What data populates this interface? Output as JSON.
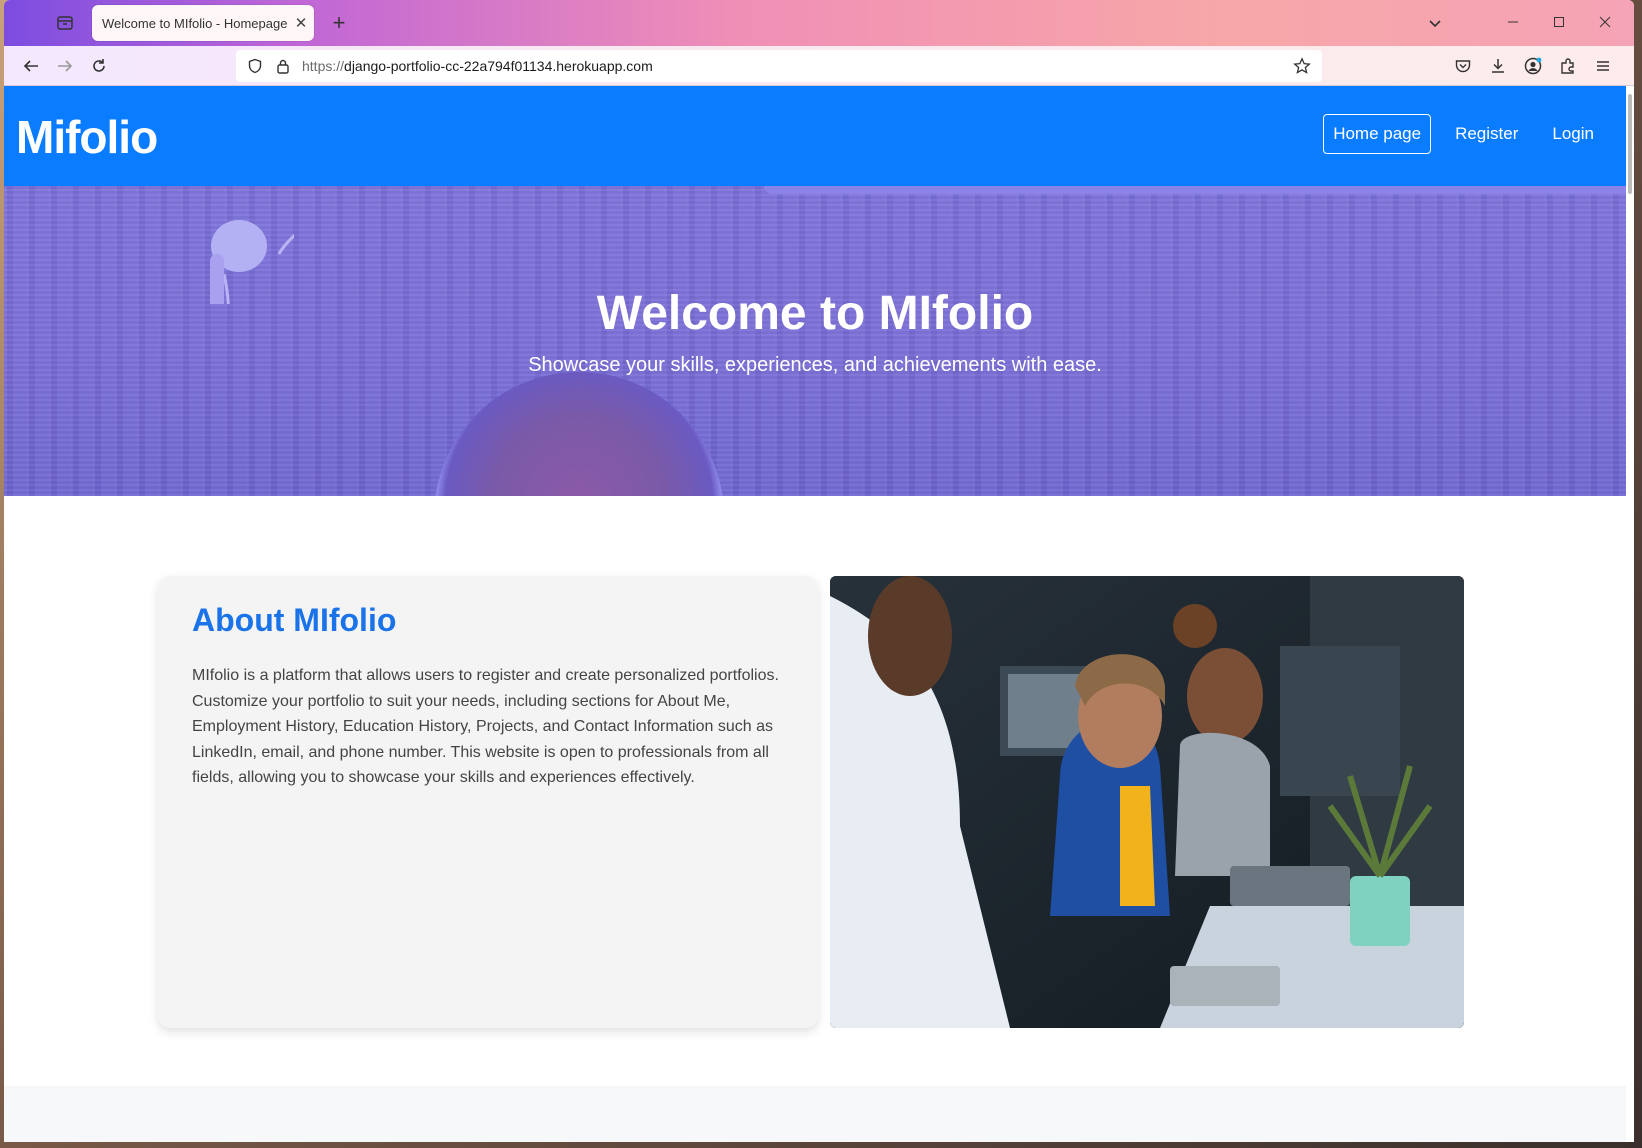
{
  "browser": {
    "tab": {
      "title": "Welcome to MIfolio - Homepage"
    },
    "url": {
      "protocol": "https://",
      "host": "django-portfolio-cc-22a794f01134.herokuapp.com"
    }
  },
  "site": {
    "brand": "Mifolio",
    "nav": [
      {
        "label": "Home page",
        "active": true
      },
      {
        "label": "Register",
        "active": false
      },
      {
        "label": "Login",
        "active": false
      }
    ],
    "hero": {
      "title": "Welcome to MIfolio",
      "subtitle": "Showcase your skills, experiences, and achievements with ease."
    },
    "about": {
      "title": "About MIfolio",
      "text": "MIfolio is a platform that allows users to register and create personalized portfolios. Customize your portfolio to suit your needs, including sections for About Me, Employment History, Education History, Projects, and Contact Information such as LinkedIn, email, and phone number. This website is open to professionals from all fields, allowing you to showcase your skills and experiences effectively."
    }
  },
  "colors": {
    "navbar": "#0a7cff",
    "hero_overlay": "#7b70da",
    "accent": "#1a73e8"
  }
}
